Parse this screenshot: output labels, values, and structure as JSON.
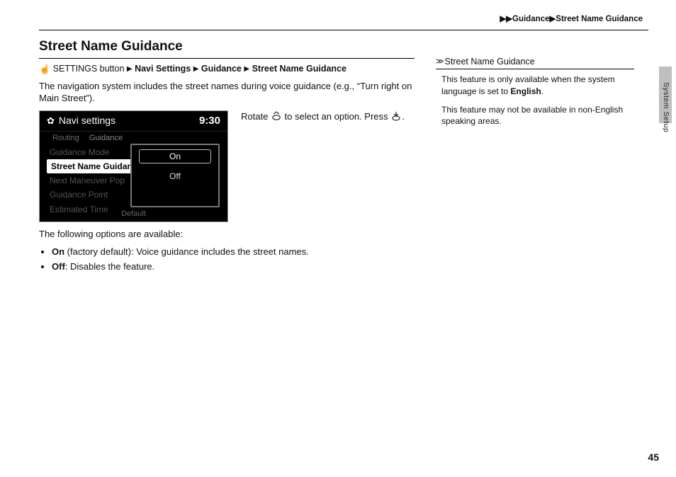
{
  "breadcrumb": {
    "arrows": "▶▶",
    "seg1": "Guidance",
    "sep": "▶",
    "seg2": "Street Name Guidance"
  },
  "heading": "Street Name Guidance",
  "path": {
    "hand": "☝",
    "prefix": " SETTINGS button ",
    "tri": "▶",
    "seg1": "Navi Settings",
    "seg2": "Guidance",
    "seg3": "Street Name Guidance"
  },
  "body1": "The navigation system includes the street names during voice guidance (e.g., “Turn right on Main Street”).",
  "screenshot": {
    "gear": "✿",
    "title": "Navi settings",
    "time": "9:30",
    "tabs": {
      "routing": "Routing",
      "guidance": "Guidance"
    },
    "menu": {
      "m1": "Guidance Mode",
      "m2": "Street Name Guidan",
      "m3": "Next Maneuver Pop",
      "m4": "Guidance Point",
      "m5": "Estimated Time"
    },
    "popup": {
      "on": "On",
      "off": "Off"
    },
    "footer": "Default"
  },
  "instr": {
    "t1": "Rotate ",
    "t2": " to select an option. Press ",
    "t3": "."
  },
  "options": {
    "intro": "The following options are available:",
    "on_label": "On",
    "on_desc": " (factory default): Voice guidance includes the street names.",
    "off_label": "Off",
    "off_desc": ": Disables the feature."
  },
  "side": {
    "sym": "≫",
    "heading": "Street Name Guidance",
    "p1a": "This feature is only available when the system language is set to ",
    "p1b": "English",
    "p1c": ".",
    "p2": "This feature may not be available in non-English speaking areas."
  },
  "edgeLabel": "System Setup",
  "pageNum": "45"
}
